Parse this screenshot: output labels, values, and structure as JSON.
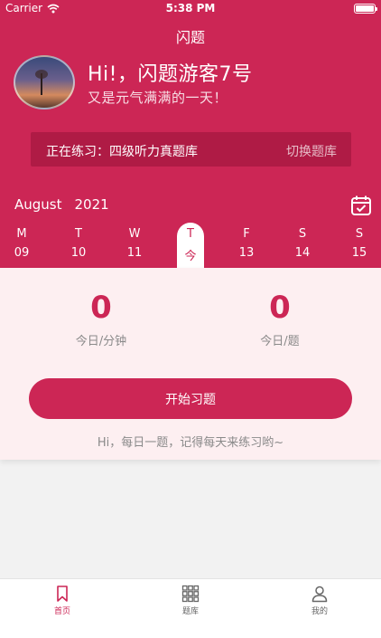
{
  "status_bar": {
    "carrier": "Carrier",
    "time": "5:38 PM"
  },
  "nav": {
    "title": "闪题"
  },
  "profile": {
    "greeting": "Hi!，闪题游客7号",
    "subtitle": "又是元气满满的一天！"
  },
  "practice": {
    "current_label": "正在练习：四级听力真题库",
    "switch_label": "切换题库"
  },
  "calendar": {
    "month": "August",
    "year": "2021",
    "days": [
      {
        "weekday": "M",
        "date": "09"
      },
      {
        "weekday": "T",
        "date": "10"
      },
      {
        "weekday": "W",
        "date": "11"
      },
      {
        "weekday": "T",
        "date": "今"
      },
      {
        "weekday": "F",
        "date": "13"
      },
      {
        "weekday": "S",
        "date": "14"
      },
      {
        "weekday": "S",
        "date": "15"
      }
    ],
    "active_index": 3
  },
  "stats": {
    "minutes_value": "0",
    "minutes_label": "今日/分钟",
    "questions_value": "0",
    "questions_label": "今日/题"
  },
  "actions": {
    "start_label": "开始习题"
  },
  "hint": "Hi，每日一题，记得每天来练习哟~",
  "tabs": [
    {
      "label": "首页",
      "icon": "bookmark-icon"
    },
    {
      "label": "题库",
      "icon": "grid-icon"
    },
    {
      "label": "我的",
      "icon": "person-icon"
    }
  ],
  "colors": {
    "brand": "#cc2655",
    "panel": "#fdeff1",
    "muted_text": "#8a8a8a"
  }
}
